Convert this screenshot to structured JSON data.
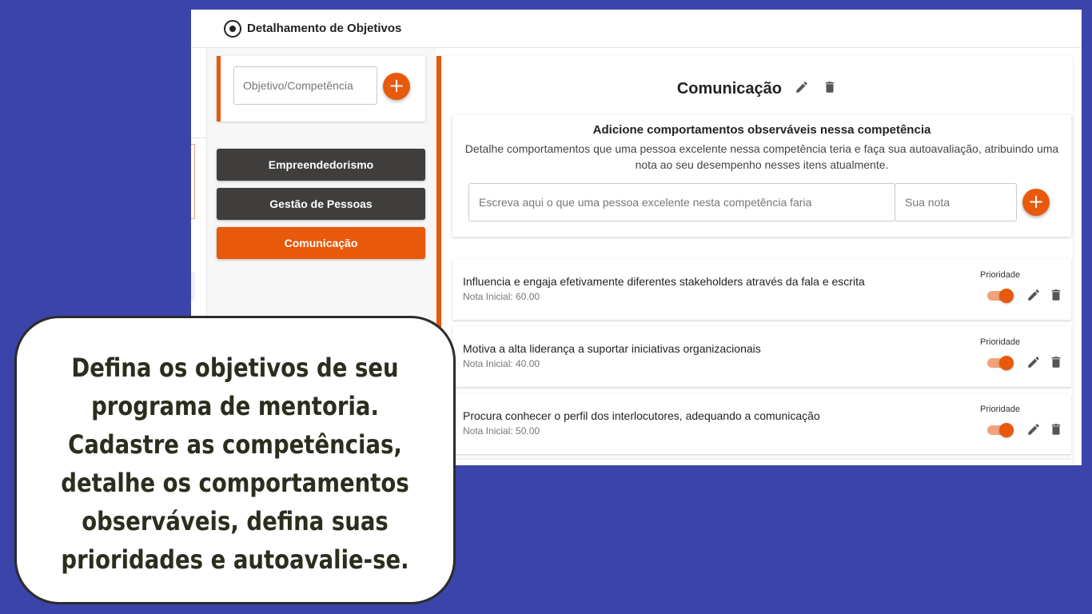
{
  "header": {
    "title": "Detalhamento de Objetivos",
    "icon": "radio-target-icon"
  },
  "sidebar": {
    "input_placeholder": "Objetivo/Competência",
    "add_icon": "+",
    "competencies": [
      {
        "label": "Empreendedorismo",
        "active": false
      },
      {
        "label": "Gestão de Pessoas",
        "active": false
      },
      {
        "label": "Comunicação",
        "active": true
      }
    ]
  },
  "main": {
    "title": "Comunicação",
    "add_section": {
      "title": "Adicione comportamentos observáveis nessa competência",
      "description": "Detalhe comportamentos que uma pessoa excelente nessa competência teria e faça sua autoavaliação, atribuindo uma nota ao seu desempenho nesses itens atualmente.",
      "behavior_placeholder": "Escreva aqui o que uma pessoa excelente nesta competência faria",
      "nota_placeholder": "Sua nota",
      "add_icon": "+"
    },
    "behaviors": [
      {
        "text": "Influencia e engaja efetivamente diferentes stakeholders através da fala e escrita",
        "nota": "Nota Inicial: 60.00",
        "priority_label": "Prioridade",
        "priority_on": true
      },
      {
        "text": "Motiva a alta liderança a suportar iniciativas organizacionais",
        "nota": "Nota Inicial: 40.00",
        "priority_label": "Prioridade",
        "priority_on": true
      },
      {
        "text": "Procura conhecer o perfil dos interlocutores, adequando a comunicação",
        "nota": "Nota Inicial: 50.00",
        "priority_label": "Prioridade",
        "priority_on": true
      }
    ]
  },
  "callout": {
    "lines": [
      "Defina os objetivos de seu",
      "programa de mentoria.",
      "Cadastre as competências,",
      "detalhe os comportamentos",
      "observáveis, defina suas",
      "prioridades e autoavalie-se."
    ]
  },
  "colors": {
    "accent": "#e8590c",
    "background": "#3b44a8",
    "dark_button": "#403e3c"
  }
}
